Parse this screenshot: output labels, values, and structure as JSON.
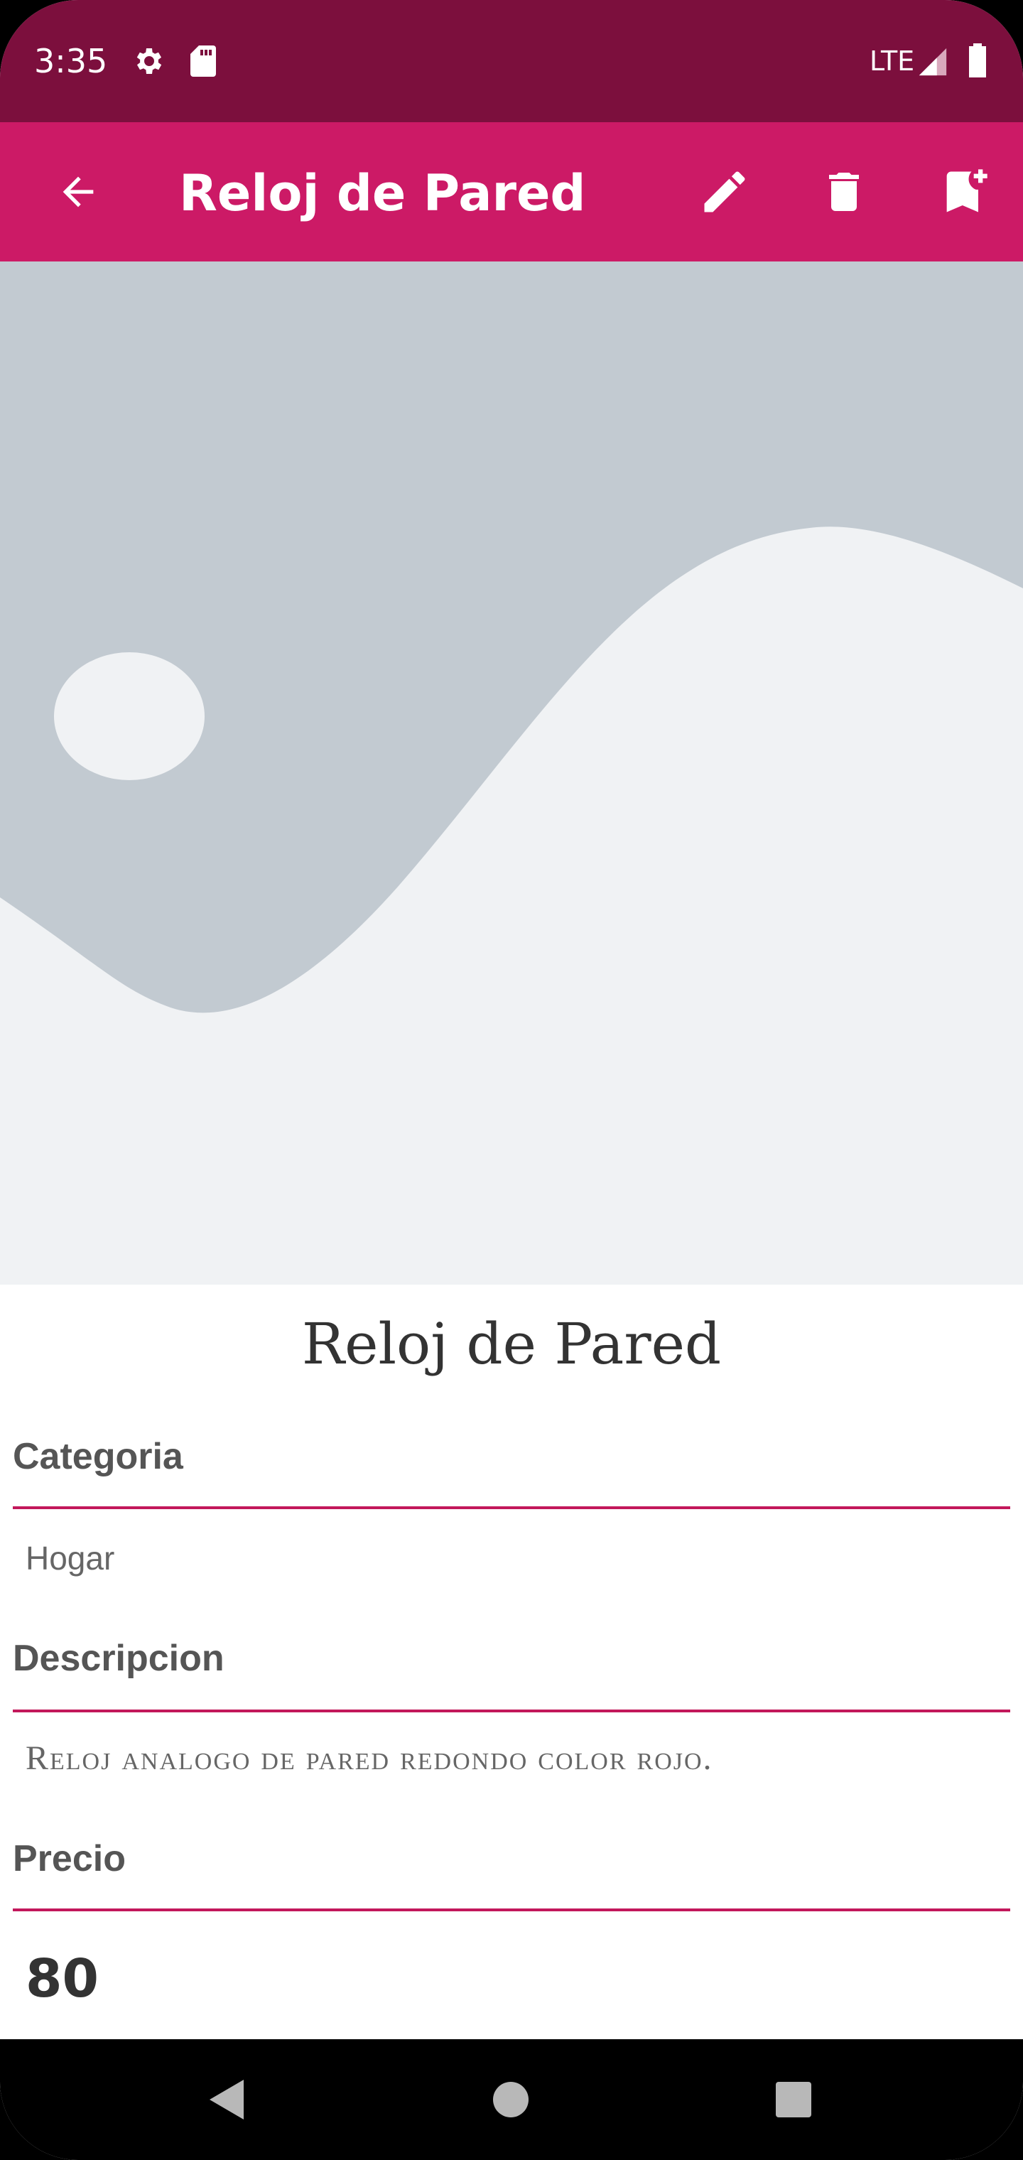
{
  "status_bar": {
    "time": "3:35",
    "network": "LTE",
    "icons": [
      "gear-icon",
      "sd-card-icon",
      "signal-icon",
      "battery-icon"
    ]
  },
  "app_bar": {
    "title": "Reloj de Pared",
    "icons": [
      "arrow-back-icon",
      "pencil-icon",
      "trash-icon",
      "bookmark-add-icon"
    ],
    "background": "#cc1a66"
  },
  "product": {
    "title": "Reloj de Pared",
    "category_label": "Categoria",
    "category_value": "Hogar",
    "description_label": "Descripcion",
    "description_value": "Reloj analogo de pared redondo color rojo.",
    "price_label": "Precio",
    "price_value": "80"
  },
  "colors": {
    "status_bar": "#7c0f3d",
    "accent": "#c2185b",
    "image_placeholder_light": "#f0f2f4",
    "image_placeholder_dark": "#c2cad1"
  },
  "nav_bar": {
    "icons": [
      "nav-back-icon",
      "nav-home-icon",
      "nav-recents-icon"
    ]
  }
}
